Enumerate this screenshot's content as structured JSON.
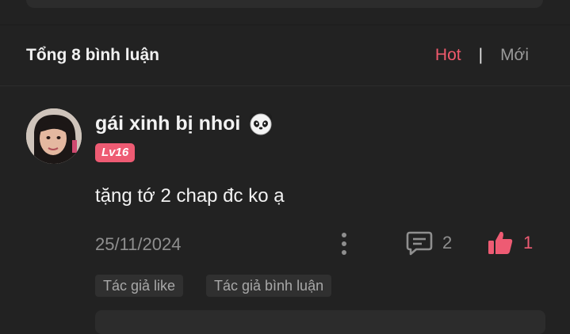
{
  "comments_header": {
    "total_label": "Tổng 8 bình luận",
    "sort_hot": "Hot",
    "sort_separator": "|",
    "sort_new": "Mới"
  },
  "comment": {
    "username": "gái xinh bị nhoi",
    "level_badge": "Lv16",
    "text": "tặng tớ 2 chap đc ko ạ",
    "date": "25/11/2024",
    "reply_count": "2",
    "like_count": "1",
    "tags": [
      "Tác giả like",
      "Tác giả bình luận"
    ]
  },
  "icons": {
    "more": "vertical-dots-icon",
    "reply": "comment-bubble-icon",
    "like": "thumbs-up-icon",
    "emoji": "panda-face-icon"
  },
  "colors": {
    "accent": "#ee5b73",
    "background": "#222222",
    "muted_text": "#8f8f8f"
  }
}
